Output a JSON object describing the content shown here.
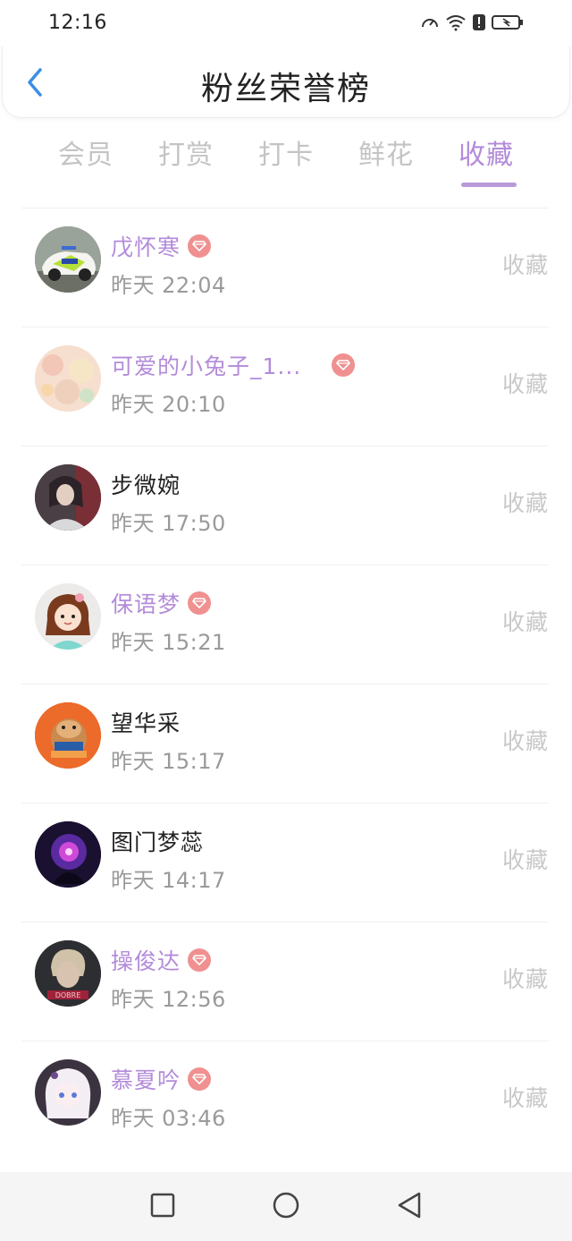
{
  "status": {
    "time": "12:16"
  },
  "header": {
    "title": "粉丝荣誉榜"
  },
  "tabs": [
    {
      "label": "会员"
    },
    {
      "label": "打赏"
    },
    {
      "label": "打卡"
    },
    {
      "label": "鲜花"
    },
    {
      "label": "收藏"
    }
  ],
  "active_tab": "收藏",
  "items": [
    {
      "name": "戊怀寒",
      "time": "昨天 22:04",
      "action": "收藏",
      "vip": true,
      "avatar_color": "#7a8a6a"
    },
    {
      "name": "可爱的小兔子_1...",
      "time": "昨天 20:10",
      "action": "收藏",
      "vip": true,
      "avatar_color": "#f3d7c4"
    },
    {
      "name": "步微婉",
      "time": "昨天 17:50",
      "action": "收藏",
      "vip": false,
      "avatar_color": "#5b4f52"
    },
    {
      "name": "保语梦",
      "time": "昨天 15:21",
      "action": "收藏",
      "vip": true,
      "avatar_color": "#e8e4df"
    },
    {
      "name": "望华采",
      "time": "昨天 15:17",
      "action": "收藏",
      "vip": false,
      "avatar_color": "#e8642c"
    },
    {
      "name": "图门梦蕊",
      "time": "昨天 14:17",
      "action": "收藏",
      "vip": false,
      "avatar_color": "#2a1a4a"
    },
    {
      "name": "操俊达",
      "time": "昨天 12:56",
      "action": "收藏",
      "vip": true,
      "avatar_color": "#3a3c40"
    },
    {
      "name": "慕夏吟",
      "time": "昨天 03:46",
      "action": "收藏",
      "vip": true,
      "avatar_color": "#d8d2d8"
    }
  ]
}
